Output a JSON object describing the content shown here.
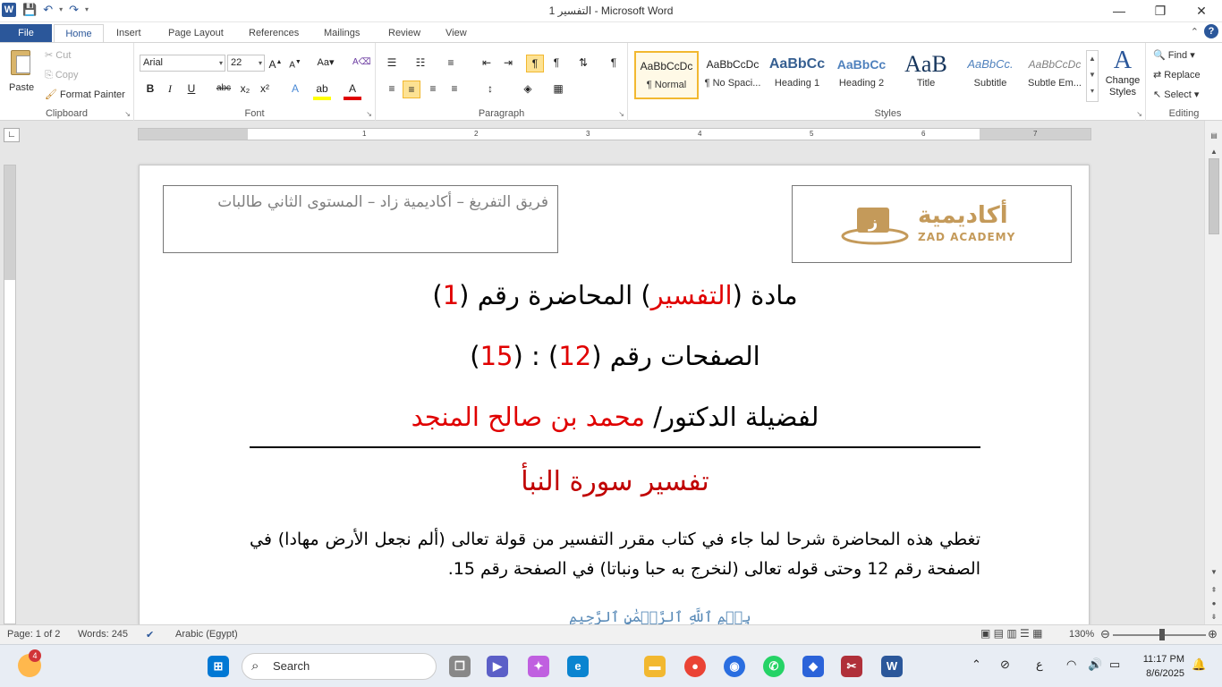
{
  "window": {
    "title": "التفسير 1  -  Microsoft Word",
    "controls": [
      "—",
      "❐",
      "✕"
    ]
  },
  "qat": {
    "app_icon": "word-icon",
    "save": "save-icon",
    "undo": "undo-icon",
    "redo": "redo-icon"
  },
  "tabs": [
    "File",
    "Home",
    "Insert",
    "Page Layout",
    "References",
    "Mailings",
    "Review",
    "View"
  ],
  "clipboard": {
    "paste": "Paste",
    "cut": "Cut",
    "copy": "Copy",
    "format_painter": "Format Painter",
    "label": "Clipboard"
  },
  "font": {
    "name": "Arial",
    "size": "22",
    "label": "Font",
    "buttons": [
      "B",
      "I",
      "U",
      "abc",
      "x₂",
      "x²"
    ]
  },
  "paragraph": {
    "label": "Paragraph"
  },
  "styles": {
    "label": "Styles",
    "items": [
      {
        "preview": "AaBbCcDc",
        "name": "¶ Normal"
      },
      {
        "preview": "AaBbCcDc",
        "name": "¶ No Spaci..."
      },
      {
        "preview": "AaBbCc",
        "name": "Heading 1"
      },
      {
        "preview": "AaBbCc",
        "name": "Heading 2"
      },
      {
        "preview": "AaB",
        "name": "Title"
      },
      {
        "preview": "AaBbCc.",
        "name": "Subtitle"
      },
      {
        "preview": "AaBbCcDc",
        "name": "Subtle Em..."
      }
    ],
    "change_styles": "Change Styles"
  },
  "editing": {
    "find": "Find",
    "replace": "Replace",
    "select": "Select",
    "label": "Editing"
  },
  "ruler": {
    "numbers": [
      "1",
      "2",
      "3",
      "4",
      "5",
      "6",
      "7"
    ]
  },
  "document": {
    "header_text": "فريق التفريغ – أكاديمية زاد – المستوى الثاني طالبات",
    "logo_ar": "أكاديمية",
    "logo_en": "ZAD ACADEMY",
    "line1": {
      "a": "مادة (",
      "b": "التفسير",
      "c": ") المحاضرة رقم (",
      "d": "1",
      "e": ")"
    },
    "line2": {
      "a": "الصفحات رقم (",
      "b": "12",
      "c": ") : (",
      "d": "15",
      "e": ")"
    },
    "line3": {
      "a": "لفضيلة الدكتور/ ",
      "b": "محمد بن صالح المنجد"
    },
    "heading": "تفسير سورة النبأ",
    "body": "تغطي هذه المحاضرة شرحا لما جاء في كتاب مقرر التفسير من قولة تعالى (ألم نجعل الأرض مهادا) في الصفحة رقم 12 وحتى قوله تعالى (لنخرج به حبا ونباتا) في الصفحة رقم 15.",
    "basmala": "بِسۡمِ ٱللَّهِ ٱلرَّحۡمَٰنِ ٱلرَّحِيمِ"
  },
  "status": {
    "page": "Page: 1 of 2",
    "words": "Words: 245",
    "language": "Arabic (Egypt)",
    "zoom": "130%"
  },
  "taskbar": {
    "search": "Search",
    "time": "11:17 PM",
    "date": "8/6/2025",
    "weather_badge": "4",
    "ime": "ع"
  },
  "colors": {
    "accent": "#2b579a",
    "red": "#e00000",
    "heading_red": "#c00000",
    "gold": "#c49a5a"
  }
}
